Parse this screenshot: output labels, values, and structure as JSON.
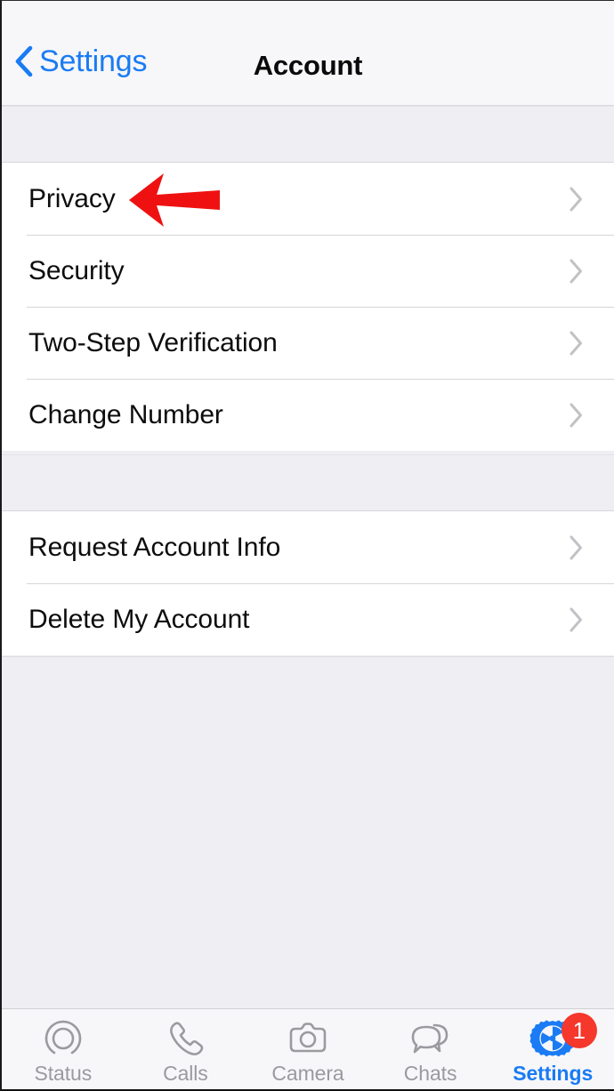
{
  "navbar": {
    "back_label": "Settings",
    "back_icon": "chevron-left-icon",
    "title": "Account"
  },
  "colors": {
    "accent_blue": "#1a7bf4",
    "annotation_red": "#ef1111",
    "badge_red": "#f5372c",
    "page_background": "#eeeef3",
    "row_background": "#ffffff",
    "separator": "#d6d6da",
    "inactive_tab": "#9a9a9f"
  },
  "annotation": {
    "type": "arrow",
    "direction": "left",
    "points_at": "Privacy",
    "color": "#ef1111"
  },
  "groups": [
    {
      "rows": [
        {
          "label": "Privacy",
          "accessory": "chevron-right-icon"
        },
        {
          "label": "Security",
          "accessory": "chevron-right-icon"
        },
        {
          "label": "Two-Step Verification",
          "accessory": "chevron-right-icon"
        },
        {
          "label": "Change Number",
          "accessory": "chevron-right-icon"
        }
      ]
    },
    {
      "rows": [
        {
          "label": "Request Account Info",
          "accessory": "chevron-right-icon"
        },
        {
          "label": "Delete My Account",
          "accessory": "chevron-right-icon"
        }
      ]
    }
  ],
  "tabbar": {
    "items": [
      {
        "label": "Status",
        "icon": "status-rings-icon",
        "active": false,
        "badge": ""
      },
      {
        "label": "Calls",
        "icon": "phone-handset-icon",
        "active": false,
        "badge": ""
      },
      {
        "label": "Camera",
        "icon": "camera-icon",
        "active": false,
        "badge": ""
      },
      {
        "label": "Chats",
        "icon": "chat-bubbles-icon",
        "active": false,
        "badge": ""
      },
      {
        "label": "Settings",
        "icon": "gear-icon",
        "active": true,
        "badge": "1"
      }
    ]
  }
}
